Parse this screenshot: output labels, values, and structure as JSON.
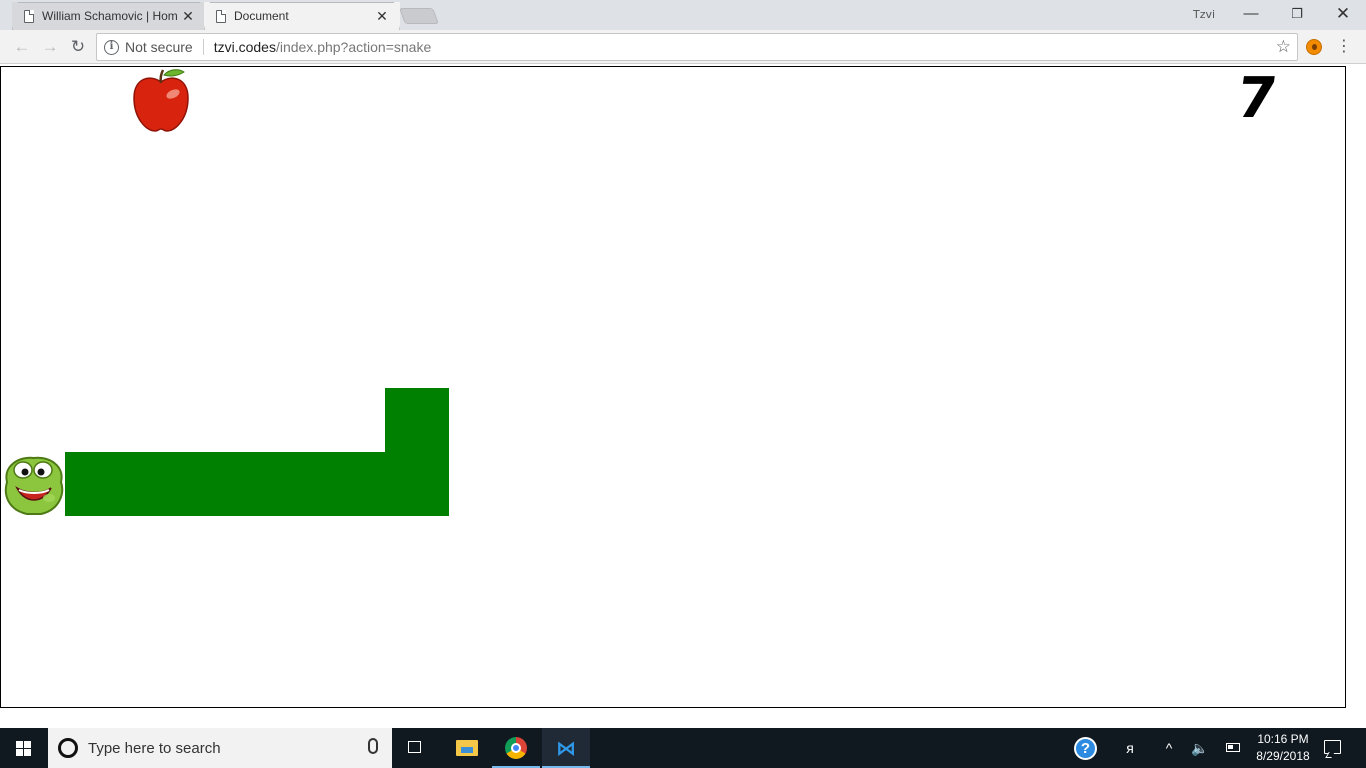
{
  "browser": {
    "tabs": [
      {
        "title": "William Schamovic | Hom",
        "active": false
      },
      {
        "title": "Document",
        "active": true
      }
    ],
    "profile_name": "Tzvi",
    "security_label": "Not secure",
    "url_host": "tzvi.codes",
    "url_path": "/index.php?action=snake",
    "window_controls": {
      "minimize": "—",
      "maximize": "❐",
      "close": "✕"
    },
    "nav_icons": {
      "back": "←",
      "forward": "→",
      "reload": "↻",
      "star": "☆",
      "menu": "⋮",
      "tab_close": "✕"
    }
  },
  "game": {
    "score": "7",
    "snake_color": "#008000",
    "grid_cell": 64,
    "apple_cell": [
      2,
      0
    ],
    "head_cell": [
      0,
      6
    ],
    "body_cells": [
      [
        1,
        6
      ],
      [
        2,
        6
      ],
      [
        3,
        6
      ],
      [
        4,
        6
      ],
      [
        5,
        6
      ],
      [
        6,
        6
      ],
      [
        6,
        5
      ]
    ],
    "head_icon": "turtle-head-icon",
    "food_icon": "apple-icon"
  },
  "taskbar": {
    "search_placeholder": "Type here to search",
    "help_glyph": "?",
    "people_glyph": "ᴙ",
    "chevron_glyph": "^",
    "volume_glyph": "🔈",
    "vscode_glyph": "⋈",
    "time": "10:16 PM",
    "date": "8/29/2018"
  }
}
